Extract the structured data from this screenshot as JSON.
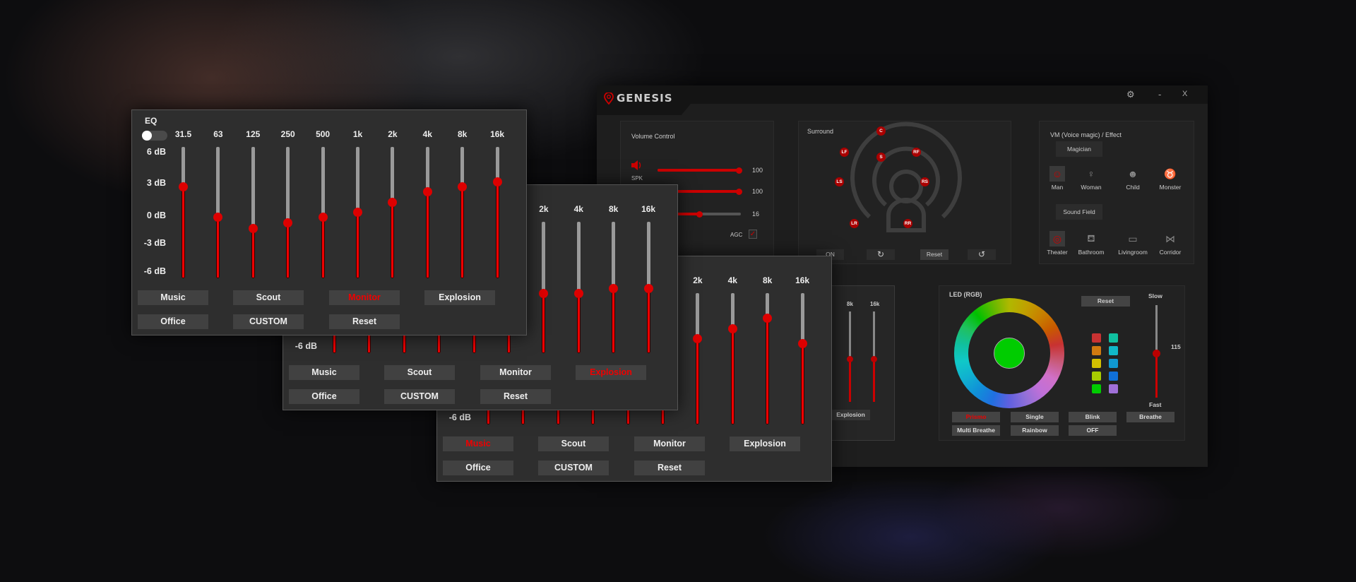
{
  "main_window": {
    "brand": "GENESIS",
    "accent": "#cc0000",
    "controls": {
      "settings_icon": "gear-icon",
      "minimize": "-",
      "close": "X"
    },
    "volume_control": {
      "title": "Volume Control",
      "speaker_label": "SPK",
      "sliders": [
        {
          "icon": "speaker-icon",
          "value": "100",
          "fraction": 1.0
        },
        {
          "value": "100",
          "fraction": 1.0
        },
        {
          "value": "16",
          "fraction": 0.5
        }
      ],
      "agc_label": "AGC",
      "agc_checked": true
    },
    "surround": {
      "title": "Surround",
      "speakers": [
        "C",
        "LF",
        "RF",
        "S",
        "LS",
        "RS",
        "LR",
        "RR"
      ],
      "on_label": "ON",
      "reset_label": "Reset"
    },
    "voice_magic": {
      "title": "VM (Voice magic) / Effect",
      "magician_label": "Magician",
      "voices": [
        "Man",
        "Woman",
        "Child",
        "Monster"
      ],
      "selected_voice": "Man",
      "sound_field_label": "Sound Field",
      "fields": [
        "Theater",
        "Bathroom",
        "Livingroom",
        "Corridor"
      ],
      "selected_field": "Theater"
    },
    "mini_eq": {
      "bands": [
        "8k",
        "16k"
      ],
      "button": "Explosion"
    },
    "led": {
      "title": "LED (RGB)",
      "reset_label": "Reset",
      "selected_color": "#00cc00",
      "swatches": [
        "#c83232",
        "#d07a10",
        "#d4c000",
        "#a8cc00",
        "#00cc00",
        "#10c0a0",
        "#10b8c8",
        "#1098d0",
        "#1070d8",
        "#a070d8"
      ],
      "speed_slow": "Slow",
      "speed_fast": "Fast",
      "speed_value": "115",
      "modes": [
        "Prismo",
        "Single",
        "Blink",
        "Breathe",
        "Multi Breathe",
        "Rainbow",
        "OFF"
      ],
      "active_mode": "Prismo"
    }
  },
  "eq_panels": [
    {
      "title": "EQ",
      "bands": [
        "31.5",
        "63",
        "125",
        "250",
        "500",
        "1k",
        "2k",
        "4k",
        "8k",
        "16k"
      ],
      "db_labels": [
        "6 dB",
        "3 dB",
        "0 dB",
        "-3 dB",
        "-6 dB"
      ],
      "values_db": [
        -1.0,
        -1.0,
        -1.0,
        -1.0,
        -1.0,
        -1.0,
        1.9,
        2.9,
        4.0,
        1.4
      ],
      "presets": [
        "Music",
        "Scout",
        "Monitor",
        "Explosion",
        "Office",
        "CUSTOM",
        "Reset"
      ],
      "active_preset": "Music"
    },
    {
      "title": "EQ",
      "bands": [
        "31.5",
        "63",
        "125",
        "250",
        "500",
        "1k",
        "2k",
        "4k",
        "8k",
        "16k"
      ],
      "db_labels": [
        "6 dB",
        "3 dB",
        "0 dB",
        "-3 dB",
        "-6 dB"
      ],
      "values_db": [
        0.5,
        0.5,
        0.5,
        0.5,
        0.5,
        0.5,
        -0.7,
        -0.7,
        -0.2,
        -0.2
      ],
      "presets": [
        "Music",
        "Scout",
        "Monitor",
        "Explosion",
        "Office",
        "CUSTOM",
        "Reset"
      ],
      "active_preset": "Explosion"
    },
    {
      "title": "EQ",
      "bands": [
        "31.5",
        "63",
        "125",
        "250",
        "500",
        "1k",
        "2k",
        "4k",
        "8k",
        "16k"
      ],
      "db_labels": [
        "6 dB",
        "3 dB",
        "0 dB",
        "-3 dB",
        "-6 dB"
      ],
      "values_db": [
        2.5,
        -0.6,
        -1.7,
        -1.1,
        -0.6,
        -0.1,
        0.9,
        2.0,
        2.5,
        3.0
      ],
      "presets": [
        "Music",
        "Scout",
        "Monitor",
        "Explosion",
        "Office",
        "CUSTOM",
        "Reset"
      ],
      "active_preset": "Monitor"
    }
  ]
}
